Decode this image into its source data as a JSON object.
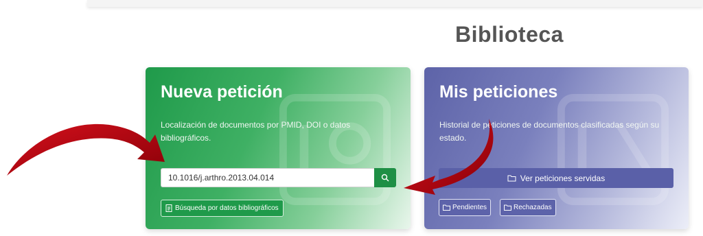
{
  "page": {
    "title": "Biblioteca"
  },
  "new_request_card": {
    "title": "Nueva petición",
    "description": "Localización de documentos por PMID, DOI o datos bibliográficos.",
    "search_value": "10.1016/j.arthro.2013.04.014",
    "biblio_button_label": "Búsqueda por datos bibliográficos"
  },
  "my_requests_card": {
    "title": "Mis peticiones",
    "description": "Historial de peticiones de documentos clasificadas según su estado.",
    "served_button_label": "Ver peticiones servidas",
    "pending_button_label": "Pendientes",
    "rejected_button_label": "Rechazadas"
  },
  "colors": {
    "green_accent": "#1f9a4a",
    "blue_accent": "#5a60a8",
    "arrow_red": "#b8000d"
  },
  "icons": [
    "search-icon",
    "document-icon",
    "folder-icon",
    "folder-open-icon",
    "red-arrow"
  ]
}
